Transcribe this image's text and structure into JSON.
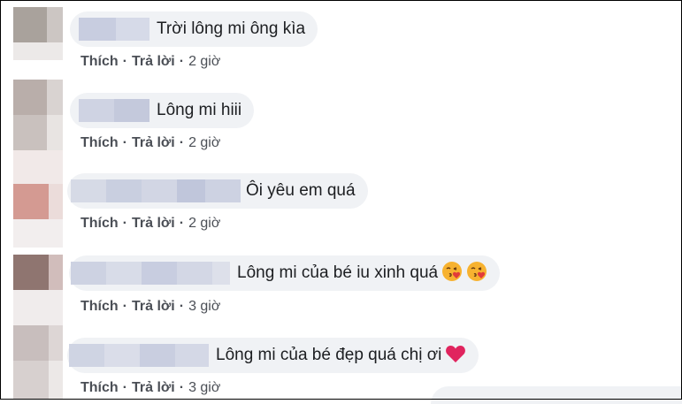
{
  "comments": [
    {
      "text": "Trời lông mi ông kìa",
      "like": "Thích",
      "reply": "Trả lời",
      "time": "2 giờ"
    },
    {
      "text": "Lông mi hiii",
      "like": "Thích",
      "reply": "Trả lời",
      "time": "2 giờ"
    },
    {
      "text": "Ôi yêu em quá",
      "like": "Thích",
      "reply": "Trả lời",
      "time": "2 giờ"
    },
    {
      "text": "Lông mi của bé iu xinh quá",
      "like": "Thích",
      "reply": "Trả lời",
      "time": "3 giờ"
    },
    {
      "text": "Lông mi của bé đẹp quá chị ơi",
      "like": "Thích",
      "reply": "Trả lời",
      "time": "3 giờ"
    }
  ],
  "separator": "·",
  "icons": {
    "comment4_emojis": [
      "kissing-face-with-heart-icon",
      "kissing-face-with-heart-icon"
    ],
    "comment5_emoji": "red-heart-icon"
  },
  "colors": {
    "bubble": "#f0f2f5",
    "action_text": "#4b4f56",
    "comment_text": "#1c1e21",
    "heart": "#e0245e"
  }
}
